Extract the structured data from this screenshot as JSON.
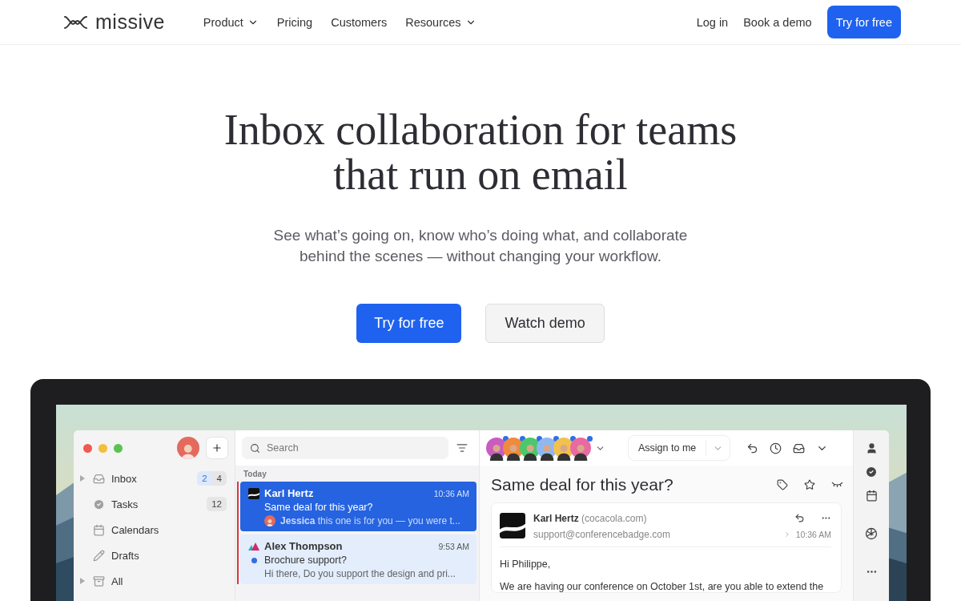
{
  "nav": {
    "logo": "missive",
    "links": [
      {
        "label": "Product",
        "dropdown": true
      },
      {
        "label": "Pricing",
        "dropdown": false
      },
      {
        "label": "Customers",
        "dropdown": false
      },
      {
        "label": "Resources",
        "dropdown": true
      }
    ],
    "login": "Log in",
    "demo": "Book a demo",
    "cta": "Try for free"
  },
  "hero": {
    "title_lines": [
      "Inbox collaboration for teams",
      "that run on email"
    ],
    "subtitle_lines": [
      "See what’s going on, know who’s doing what, and collaborate",
      "behind the scenes — without changing your workflow."
    ],
    "primary": "Try for free",
    "secondary": "Watch demo"
  },
  "app": {
    "sidebar": {
      "items": [
        {
          "label": "Inbox",
          "kind": "inbox",
          "expandable": true,
          "counts": [
            {
              "text": "2",
              "kind": "unread"
            },
            {
              "text": "4",
              "kind": "total"
            }
          ]
        },
        {
          "label": "Tasks",
          "kind": "tasks",
          "expandable": false,
          "counts": [
            {
              "text": "12",
              "kind": "total"
            }
          ]
        },
        {
          "label": "Calendars",
          "kind": "calendars",
          "expandable": false
        },
        {
          "label": "Drafts",
          "kind": "drafts",
          "expandable": false
        },
        {
          "label": "All",
          "kind": "all",
          "expandable": true
        }
      ]
    },
    "search": {
      "placeholder": "Search"
    },
    "list": {
      "section": "Today",
      "messages": [
        {
          "sender": "Karl Hertz",
          "kind": "wave",
          "time": "10:36 AM",
          "subject": "Same deal for this year?",
          "preview": "**Jessica** this one is for you — you were t...",
          "has_avatar": true,
          "unread": false,
          "selected": true
        },
        {
          "sender": "Alex Thompson",
          "kind": "peaks",
          "time": "9:53 AM",
          "subject": "Brochure support?",
          "preview": "Hi there, Do you support the design and pri...",
          "has_avatar": false,
          "unread": true,
          "selected": false
        }
      ]
    },
    "participants": [
      {
        "color": "#c85cc0"
      },
      {
        "color": "#f08a3c"
      },
      {
        "color": "#4cc76a"
      },
      {
        "color": "#8fb8f0"
      },
      {
        "color": "#f2c14e"
      },
      {
        "color": "#e86aa0"
      }
    ],
    "assign": "Assign to me",
    "conversation": {
      "subject": "Same deal for this year?",
      "sender": "Karl Hertz",
      "org": "(cocacola.com)",
      "address": "support@conferencebadge.com",
      "time": "10:36 AM",
      "greeting": "Hi Philippe,",
      "body": "We are having our conference on October 1st, are you able to extend the"
    }
  }
}
